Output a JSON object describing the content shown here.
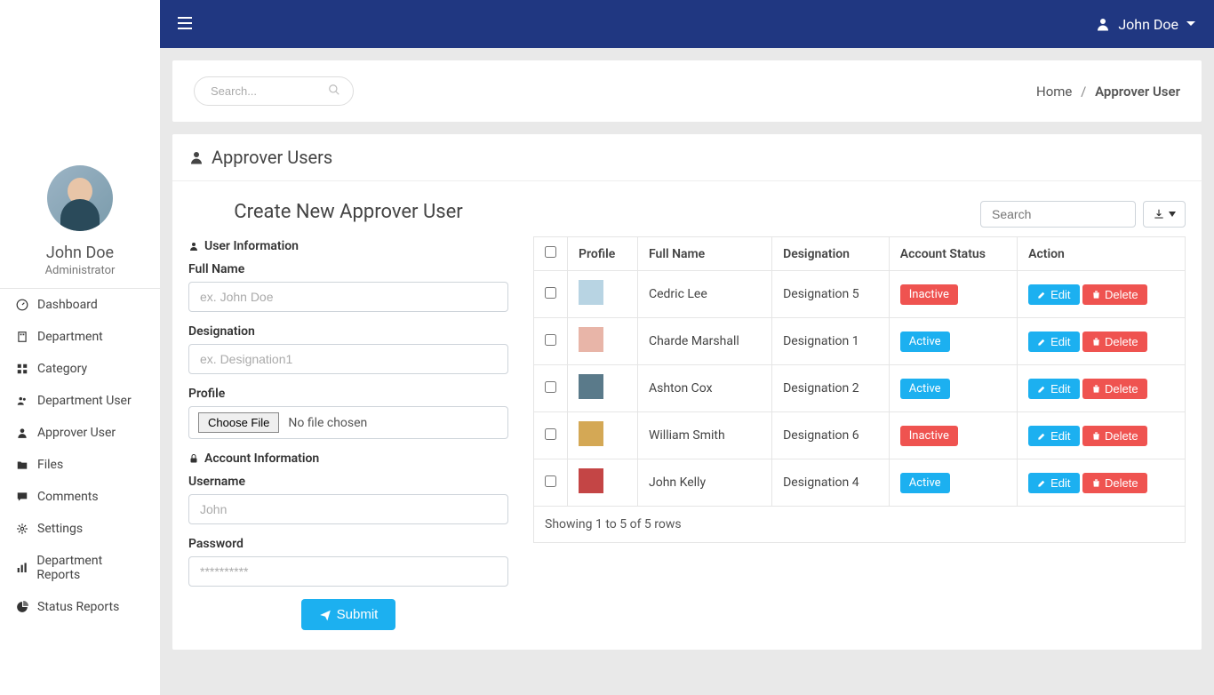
{
  "topbar": {
    "user_name": "John Doe"
  },
  "sidebar": {
    "profile_name": "John Doe",
    "profile_role": "Administrator",
    "items": [
      {
        "icon": "dashboard",
        "label": "Dashboard"
      },
      {
        "icon": "building",
        "label": "Department"
      },
      {
        "icon": "th",
        "label": "Category"
      },
      {
        "icon": "users",
        "label": "Department User"
      },
      {
        "icon": "user",
        "label": "Approver User"
      },
      {
        "icon": "folder",
        "label": "Files"
      },
      {
        "icon": "comment",
        "label": "Comments"
      },
      {
        "icon": "gear",
        "label": "Settings"
      },
      {
        "icon": "bar-chart",
        "label": "Department Reports"
      },
      {
        "icon": "pie-chart",
        "label": "Status Reports"
      }
    ]
  },
  "breadcrumb": {
    "search_placeholder": "Search...",
    "home": "Home",
    "current": "Approver User"
  },
  "page": {
    "title": "Approver Users",
    "form_title": "Create New Approver User",
    "section_user": "User Information",
    "section_account": "Account Information",
    "full_name_label": "Full Name",
    "full_name_placeholder": "ex. John Doe",
    "designation_label": "Designation",
    "designation_placeholder": "ex. Designation1",
    "profile_label": "Profile",
    "choose_file": "Choose File",
    "no_file": "No file chosen",
    "username_label": "Username",
    "username_placeholder": "John",
    "password_label": "Password",
    "password_placeholder": "**********",
    "submit": "Submit"
  },
  "table": {
    "search_placeholder": "Search",
    "headers": {
      "profile": "Profile",
      "full_name": "Full Name",
      "designation": "Designation",
      "status": "Account Status",
      "action": "Action"
    },
    "rows": [
      {
        "name": "Cedric Lee",
        "designation": "Designation 5",
        "status": "Inactive",
        "status_type": "inactive",
        "thumb": "#b8d4e3"
      },
      {
        "name": "Charde Marshall",
        "designation": "Designation 1",
        "status": "Active",
        "status_type": "active",
        "thumb": "#e8b5a8"
      },
      {
        "name": "Ashton Cox",
        "designation": "Designation 2",
        "status": "Active",
        "status_type": "active",
        "thumb": "#5a7a8a"
      },
      {
        "name": "William Smith",
        "designation": "Designation 6",
        "status": "Inactive",
        "status_type": "inactive",
        "thumb": "#d4a855"
      },
      {
        "name": "John Kelly",
        "designation": "Designation 4",
        "status": "Active",
        "status_type": "active",
        "thumb": "#c44545"
      }
    ],
    "edit": "Edit",
    "delete": "Delete",
    "footer": "Showing 1 to 5 of 5 rows"
  },
  "colors": {
    "topbar": "#203781",
    "primary": "#1cb0f0",
    "danger": "#ef5350"
  }
}
